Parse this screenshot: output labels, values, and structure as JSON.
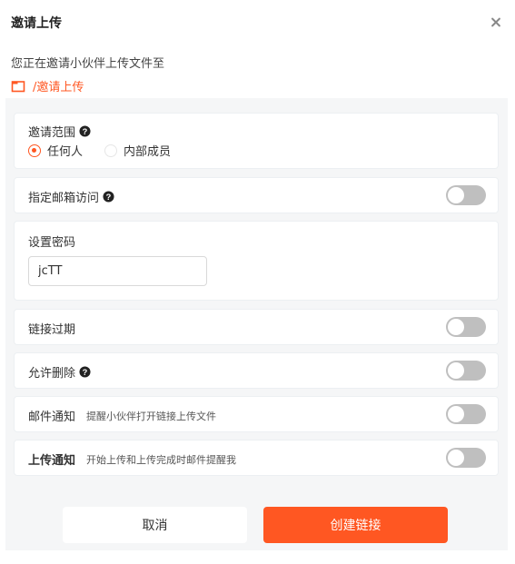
{
  "dialog": {
    "title": "邀请上传",
    "subtitle": "您正在邀请小伙伴上传文件至",
    "folder_path": "/邀请上传"
  },
  "scope": {
    "label": "邀请范围",
    "options": [
      "任何人",
      "内部成员"
    ],
    "selected": "任何人"
  },
  "email_access": {
    "label": "指定邮箱访问",
    "enabled": false
  },
  "password": {
    "label": "设置密码",
    "value": "jcTT"
  },
  "link_expire": {
    "label": "链接过期",
    "enabled": false
  },
  "allow_delete": {
    "label": "允许删除",
    "enabled": false
  },
  "email_notify": {
    "label": "邮件通知",
    "hint": "提醒小伙伴打开链接上传文件",
    "enabled": false
  },
  "upload_notify": {
    "label": "上传通知",
    "hint": "开始上传和上传完成时邮件提醒我",
    "enabled": false
  },
  "buttons": {
    "cancel": "取消",
    "create": "创建链接"
  },
  "colors": {
    "accent": "#ff5722",
    "toggle_off": "#bfbfbf",
    "panel_bg": "#f5f6f7"
  }
}
